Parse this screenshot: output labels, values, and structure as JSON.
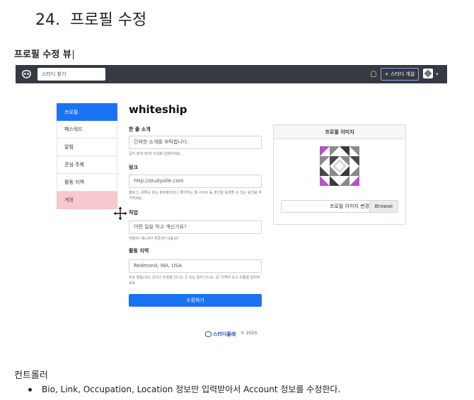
{
  "doc": {
    "number": "24.",
    "title": "프로필 수정",
    "subtitle": "프로필 수정 뷰",
    "controller_title": "컨트롤러",
    "controller_bullet": "Bio, Link, Occupation, Location 정보만 입력받아서 Account 정보를 수정한다."
  },
  "navbar": {
    "logo_icon": "owl-logo-icon",
    "search_placeholder": "스터디 찾기",
    "bell_icon": "bell-icon",
    "create_study_label": "+ 스터디 개설",
    "avatar_icon": "identicon-avatar",
    "dropdown_icon": "caret-down-icon"
  },
  "sidebar": {
    "items": [
      {
        "label": "프로필",
        "state": "active"
      },
      {
        "label": "패스워드",
        "state": "normal"
      },
      {
        "label": "알림",
        "state": "normal"
      },
      {
        "label": "관심 주제",
        "state": "normal"
      },
      {
        "label": "활동 지역",
        "state": "normal"
      },
      {
        "label": "계정",
        "state": "danger"
      }
    ]
  },
  "form": {
    "username": "whiteship",
    "bio": {
      "label": "한 줄 소개",
      "placeholder": "간략한 소개를 부탁합니다.",
      "help": "길지 않게 35자 이내로 입력하세요."
    },
    "link": {
      "label": "링크",
      "placeholder": "http://studyolle.com",
      "help": "블로그, 유튜브 또는 포트폴리오나 좋아하는 웹 사이트 등 본인을 표현할 수 있는 링크를 추가하세요."
    },
    "occupation": {
      "label": "직업",
      "placeholder": "어떤 일을 하고 계신가요?",
      "help": "개발자? 매니저? 취준생? 대표님?"
    },
    "location": {
      "label": "활동 지역",
      "placeholder": "Redmond, WA, USA",
      "help": "주요 활동(사는 곳이나 직장을 다니는 곳 또는 놀러 다니는 곳) 지역의 도시 이름을 알려주세요."
    },
    "submit_label": "수정하기"
  },
  "profile_image": {
    "header": "프로필 이미지",
    "file_label": "프로필 이미지 변경",
    "browse_label": "Browse"
  },
  "footer": {
    "logo_text": "스터디올래",
    "copyright": "© 2020"
  },
  "colors": {
    "navbar": "#343a40",
    "primary": "#1a73f0",
    "danger_bg": "#f6c9cf",
    "identicon_purple": "#b455c6"
  }
}
